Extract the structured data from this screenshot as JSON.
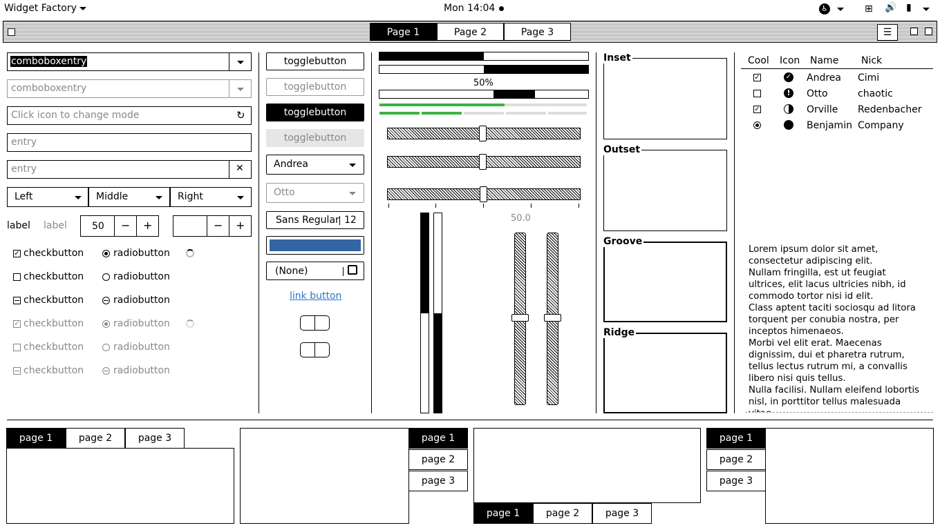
{
  "topbar": {
    "app_name": "Widget Factory",
    "clock": "Mon 14:04"
  },
  "stack": {
    "pages": [
      "Page 1",
      "Page 2",
      "Page 3"
    ]
  },
  "col1": {
    "combo1_value": "comboboxentry",
    "combo2_value": "comboboxentry",
    "entry_mode_placeholder": "Click icon to change mode",
    "entry1_value": "entry",
    "entry2_value": "entry",
    "combos": [
      "Left",
      "Middle",
      "Right"
    ],
    "label_active": "label",
    "label_dim": "label",
    "spin1_value": "50",
    "spin2_value": "",
    "check_label": "checkbutton",
    "radio_label": "radiobutton"
  },
  "col2": {
    "toggles": [
      "togglebutton",
      "togglebutton",
      "togglebutton",
      "togglebutton"
    ],
    "combo_andrea": "Andrea",
    "combo_otto": "Otto",
    "font_name": "Sans Regular",
    "font_size": "12",
    "file_chooser": "(None)",
    "link": "link button",
    "color_button": "#3465a4"
  },
  "col3": {
    "progress_label": "50%",
    "scale_value": "50.0",
    "progress": [
      0.5,
      0.5,
      0.5
    ],
    "level_fill": 0.6,
    "hscale_value": 0.5,
    "vprogress": [
      0.5,
      0.5
    ],
    "vscale_value": 0.5
  },
  "frames": [
    "Inset",
    "Outset",
    "Groove",
    "Ridge"
  ],
  "tree": {
    "headers": [
      "Cool",
      "Icon",
      "Name",
      "Nick"
    ],
    "rows": [
      {
        "name": "Andrea",
        "nick": "Cimi"
      },
      {
        "name": "Otto",
        "nick": "chaotic"
      },
      {
        "name": "Orville",
        "nick": "Redenbacher"
      },
      {
        "name": "Benjamin",
        "nick": "Company"
      }
    ]
  },
  "lorem": [
    "Lorem ipsum dolor sit amet,",
    "consectetur adipiscing elit.",
    "Nullam fringilla, est ut feugiat",
    "ultrices, elit lacus ultricies nibh, id",
    "commodo tortor nisi id elit.",
    "Class aptent taciti sociosqu ad litora",
    "torquent per conubia nostra, per",
    "inceptos himenaeos.",
    "Morbi vel elit erat. Maecenas",
    "dignissim, dui et pharetra rutrum,",
    "tellus lectus rutrum mi, a convallis",
    "libero nisi quis tellus.",
    "Nulla facilisi. Nullam eleifend lobortis",
    "nisl, in porttitor tellus malesuada",
    "vitae."
  ],
  "notebooks": {
    "tabs": [
      "page 1",
      "page 2",
      "page 3"
    ]
  }
}
